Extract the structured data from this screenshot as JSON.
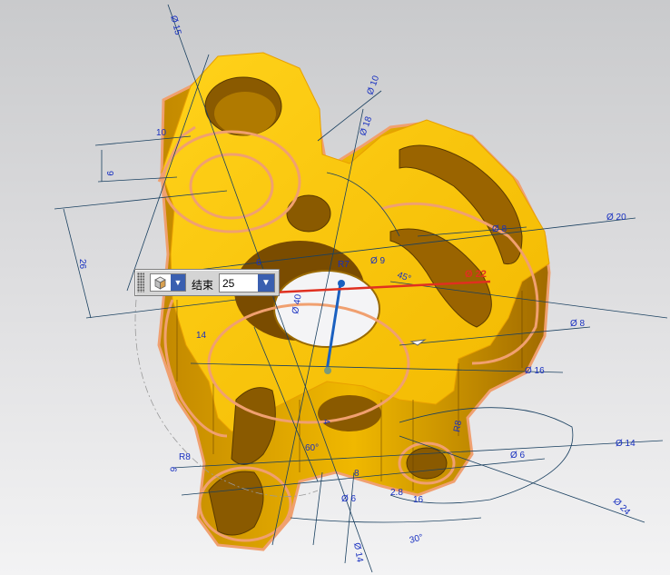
{
  "toolbar": {
    "end_label": "结束",
    "end_value": "25",
    "type_icon": "cube-view-icon",
    "dropdown_icon": "chevron-down-icon"
  },
  "dimensions": {
    "d15": "Ø 15",
    "d10": "Ø 10",
    "d18": "Ø 18",
    "d20": "Ø 20",
    "d8_upper": "Ø 8",
    "d8_right": "Ø 8",
    "d9": "Ø 9",
    "d22": "Ø 22",
    "d16": "Ø 16",
    "d6_right": "Ø 6",
    "d14_right": "Ø 14",
    "d24": "Ø 24",
    "d6_bottom": "Ø 6",
    "d16_bottom": "16",
    "d14_bottom": "Ø 14",
    "d40": "Ø 40",
    "r7": "R7",
    "dim10": "10",
    "dim9_left": "9",
    "dim26": "26",
    "dim6": "6",
    "dim14": "14",
    "dim9_lower": "9",
    "dim8": "8",
    "dim28": "2.8",
    "ang45": "45°",
    "ang60": "60°",
    "ang30": "30°",
    "r8_left": "R8",
    "r8_right": "R8",
    "dim4": "4"
  },
  "colors": {
    "part_yellow": "#f5c200",
    "part_dark": "#b07a00",
    "sketch_orange": "#f0a070",
    "dim_line": "#1a4060",
    "dim_text": "#1830c0",
    "accent_red": "#e03020",
    "axis_blue": "#1a60c0"
  }
}
